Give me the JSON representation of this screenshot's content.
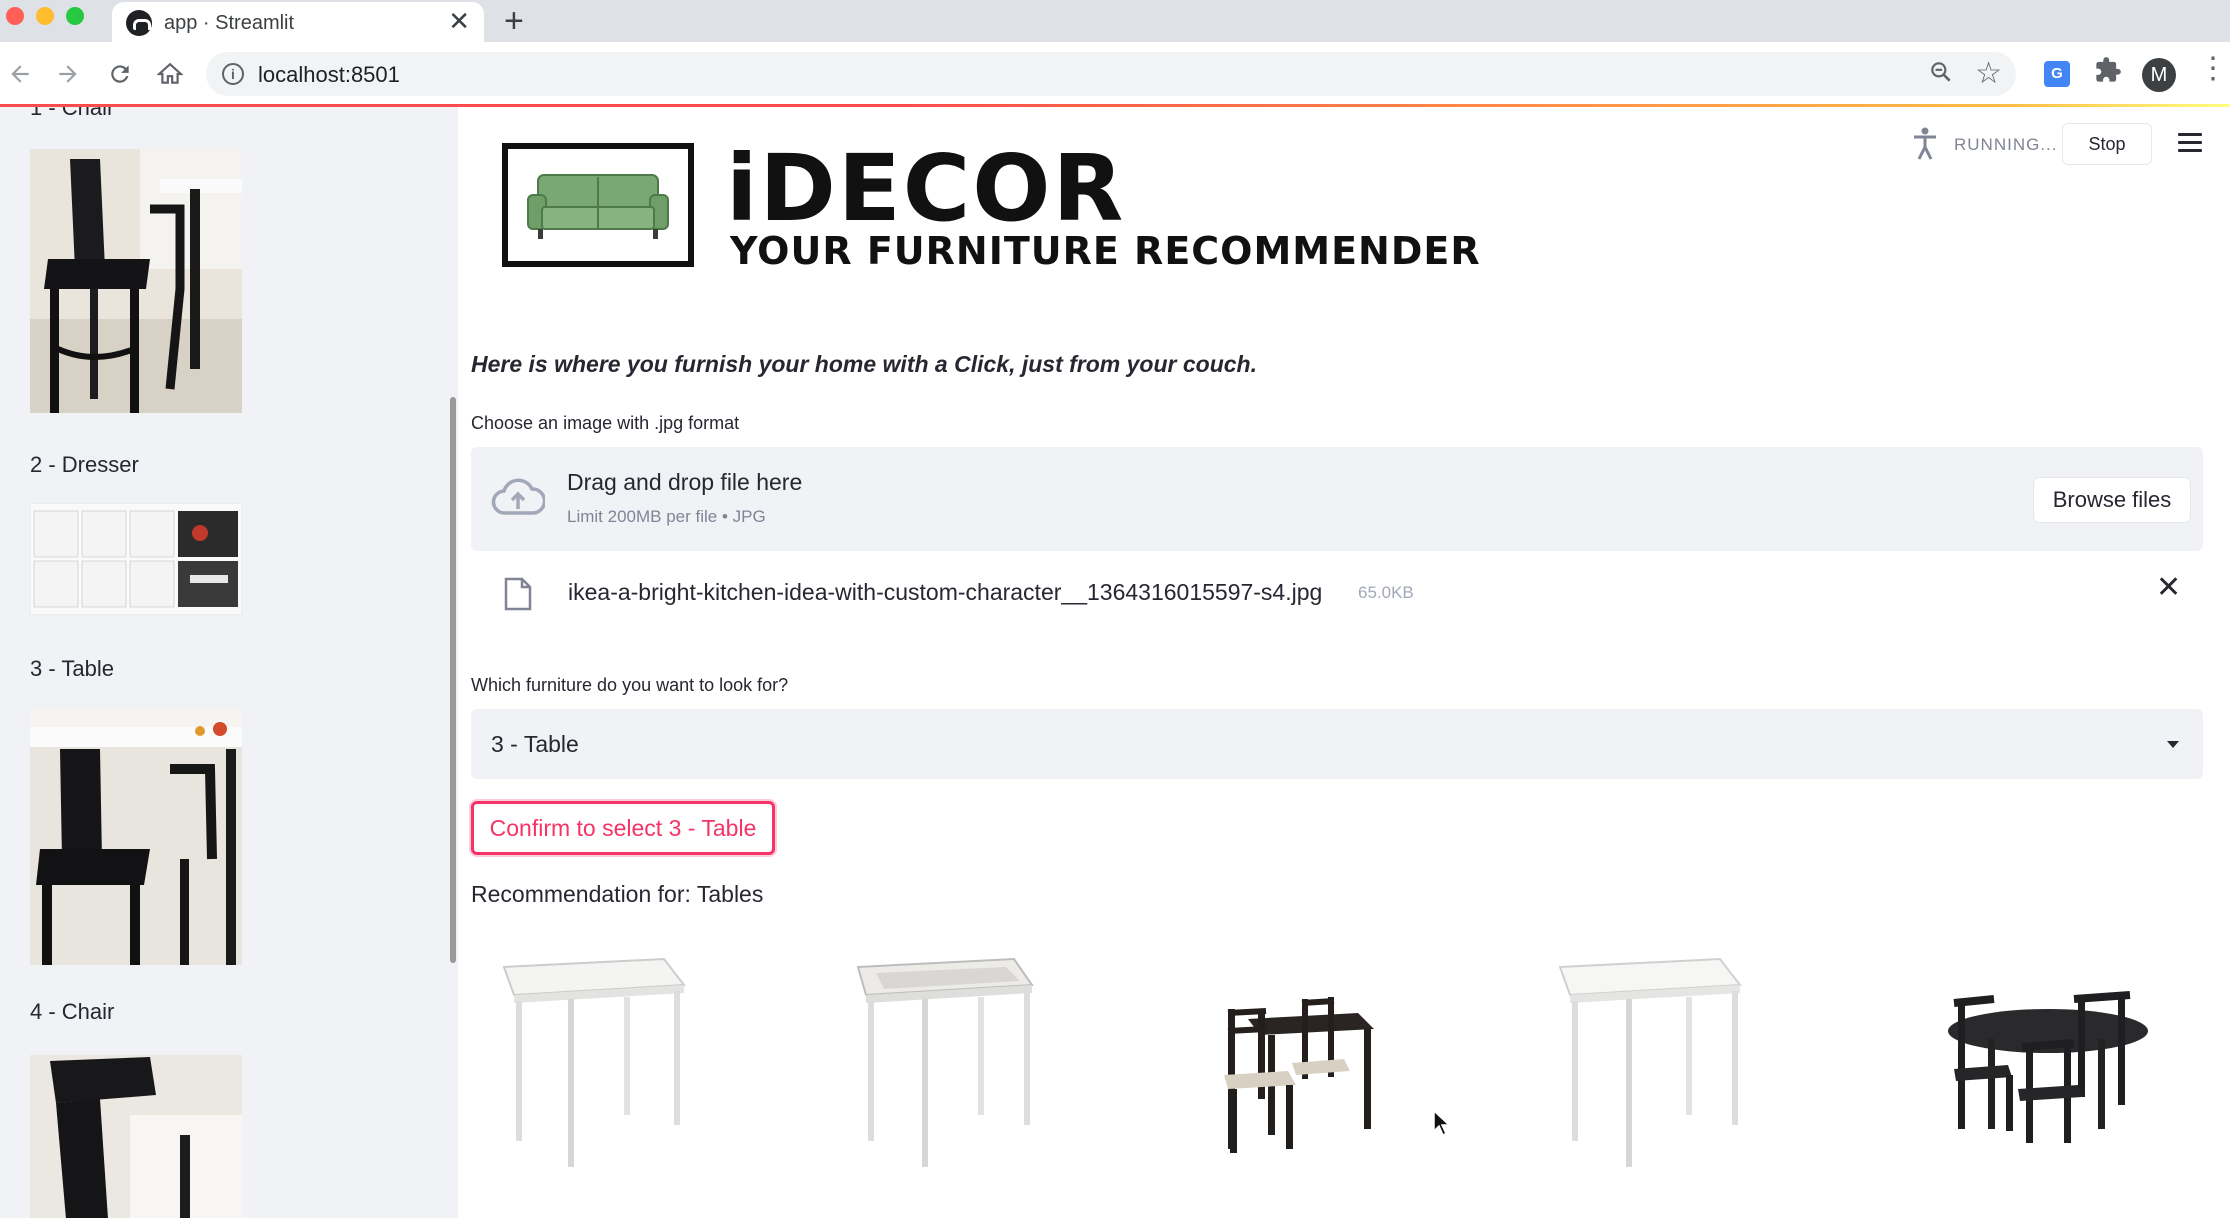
{
  "browser": {
    "tab_title": "app · Streamlit",
    "new_tab_symbol": "+",
    "close_symbol": "✕",
    "url": "localhost:8501",
    "avatar_initial": "M",
    "icons": [
      "back-icon",
      "forward-icon",
      "reload-icon",
      "home-icon",
      "info-icon",
      "zoom-icon",
      "star-icon",
      "translate-icon",
      "extensions-icon",
      "chrome-menu-icon"
    ]
  },
  "sidebar": {
    "items": [
      {
        "label": "1 - Chair"
      },
      {
        "label": "2 - Dresser"
      },
      {
        "label": "3 - Table"
      },
      {
        "label": "4 - Chair"
      }
    ]
  },
  "header": {
    "brand_title": "iDECOR",
    "brand_subtitle": "YOUR FURNITURE RECOMMENDER",
    "status": "RUNNING...",
    "stop_label": "Stop"
  },
  "main": {
    "tagline": "Here is where you furnish your home with a Click, just from your couch.",
    "uploader": {
      "label": "Choose an image with .jpg format",
      "drop_title": "Drag and drop file here",
      "drop_limit": "Limit 200MB per file • JPG",
      "browse_label": "Browse files"
    },
    "uploaded_file": {
      "name": "ikea-a-bright-kitchen-idea-with-custom-character__1364316015597-s4.jpg",
      "size": "65.0KB"
    },
    "select": {
      "label": "Which furniture do you want to look for?",
      "value": "3 - Table"
    },
    "confirm_label": "Confirm to select 3 - Table",
    "recommendation_title": "Recommendation for: Tables"
  },
  "colors": {
    "accent": "#f63366",
    "sidebar_bg": "#f0f2f6",
    "text": "#262730",
    "muted": "#808495"
  }
}
